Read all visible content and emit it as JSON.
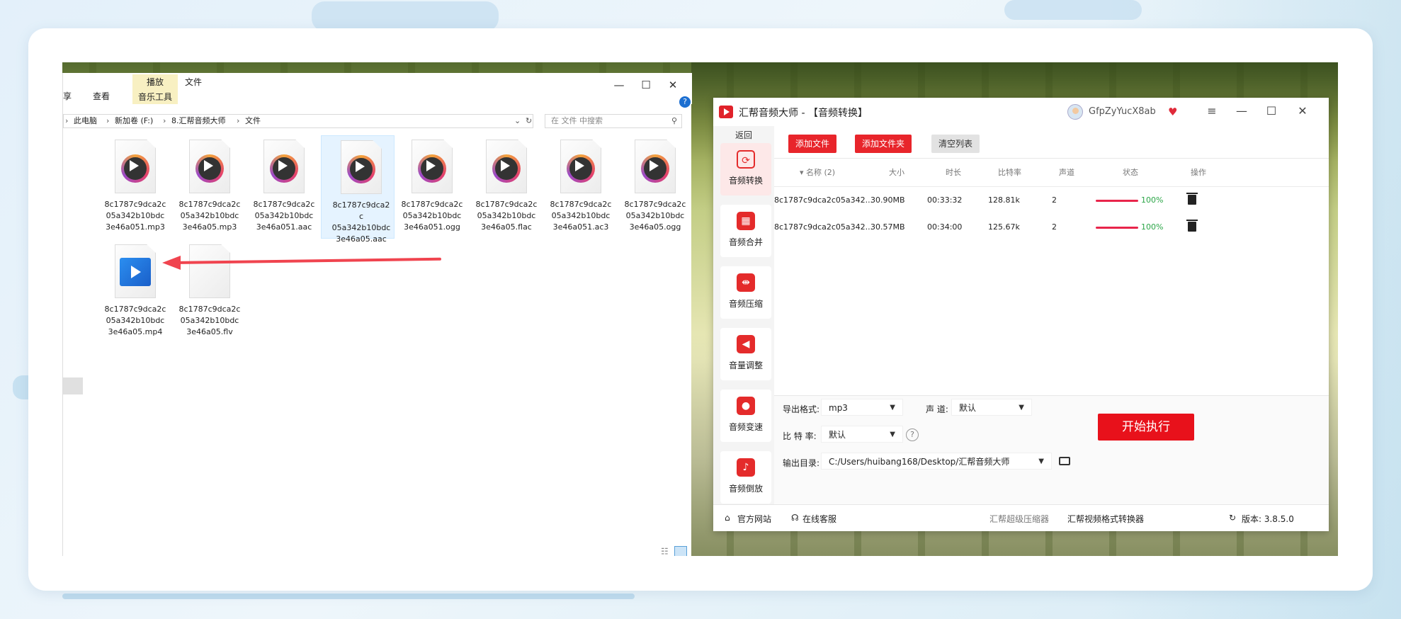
{
  "explorer": {
    "ribbon": {
      "share_fragment": "享",
      "view_tab": "查看",
      "play_tab": "播放",
      "music_tools_tab": "音乐工具",
      "file_tab": "文件"
    },
    "window_controls": {
      "minimize": "—",
      "maximize": "☐",
      "close": "✕"
    },
    "help": "?",
    "breadcrumb": [
      "此电脑",
      "新加卷 (F:)",
      "8.汇帮音频大师",
      "文件"
    ],
    "search_placeholder": "在 文件 中搜索",
    "files": [
      {
        "name": "8c1787c9dca2c05a342b10bdc3e46a051.mp3",
        "kind": "audio"
      },
      {
        "name": "8c1787c9dca2c05a342b10bdc3e46a05.mp3",
        "kind": "audio"
      },
      {
        "name": "8c1787c9dca2c05a342b10bdc3e46a051.aac",
        "kind": "audio"
      },
      {
        "name": "8c1787c9dca2c05a342b10bdc3e46a05.aac",
        "kind": "audio",
        "selected": true
      },
      {
        "name": "8c1787c9dca2c05a342b10bdc3e46a051.ogg",
        "kind": "audio"
      },
      {
        "name": "8c1787c9dca2c05a342b10bdc3e46a05.flac",
        "kind": "audio"
      },
      {
        "name": "8c1787c9dca2c05a342b10bdc3e46a051.ac3",
        "kind": "audio"
      },
      {
        "name": "8c1787c9dca2c05a342b10bdc3e46a05.ogg",
        "kind": "audio"
      },
      {
        "name": "8c1787c9dca2c05a342b10bdc3e46a05.mp4",
        "kind": "video"
      },
      {
        "name": "8c1787c9dca2c05a342b10bdc3e46a05.flv",
        "kind": "blank"
      }
    ],
    "file_name_lines": [
      [
        "8c1787c9dca2c",
        "05a342b10bdc",
        "3e46a051.mp3"
      ],
      [
        "8c1787c9dca2c",
        "05a342b10bdc",
        "3e46a05.mp3"
      ],
      [
        "8c1787c9dca2c",
        "05a342b10bdc",
        "3e46a051.aac"
      ],
      [
        "8c1787c9dca2c",
        "05a342b10bdc",
        "3e46a05.aac"
      ],
      [
        "8c1787c9dca2c",
        "05a342b10bdc",
        "3e46a051.ogg"
      ],
      [
        "8c1787c9dca2c",
        "05a342b10bdc",
        "3e46a05.flac"
      ],
      [
        "8c1787c9dca2c",
        "05a342b10bdc",
        "3e46a051.ac3"
      ],
      [
        "8c1787c9dca2c",
        "05a342b10bdc",
        "3e46a05.ogg"
      ],
      [
        "8c1787c9dca2c",
        "05a342b10bdc",
        "3e46a05.mp4"
      ],
      [
        "8c1787c9dca2c",
        "05a342b10bdc",
        "3e46a05.flv"
      ]
    ]
  },
  "app": {
    "title": "汇帮音频大师 - 【音频转换】",
    "username": "GfpZyYucX8ab",
    "window_controls": {
      "menu": "≡",
      "minimize": "—",
      "maximize": "☐",
      "close": "✕"
    },
    "back_label": "返回",
    "nav": [
      {
        "label": "音频转换",
        "icon": "convert-icon",
        "glyph": "⟳",
        "active": true
      },
      {
        "label": "音频合并",
        "icon": "merge-icon",
        "glyph": "▦"
      },
      {
        "label": "音频压缩",
        "icon": "compress-icon",
        "glyph": "⇼"
      },
      {
        "label": "音量调整",
        "icon": "volume-icon",
        "glyph": "◀"
      },
      {
        "label": "音频变速",
        "icon": "speed-icon",
        "glyph": "●"
      },
      {
        "label": "音频倒放",
        "icon": "reverse-icon",
        "glyph": "♪"
      }
    ],
    "toolbar": {
      "add_file": "添加文件",
      "add_folder": "添加文件夹",
      "clear_list": "清空列表"
    },
    "table": {
      "headers": {
        "name": "▾ 名称 (2)",
        "size": "大小",
        "duration": "时长",
        "bitrate": "比特率",
        "channels": "声道",
        "status": "状态",
        "actions": "操作"
      },
      "rows": [
        {
          "name": "8c1787c9dca2c05a342...",
          "size": "30.90MB",
          "duration": "00:33:32",
          "bitrate": "128.81k",
          "channels": "2",
          "progress": 1.0,
          "progress_label": "100%"
        },
        {
          "name": "8c1787c9dca2c05a342...",
          "size": "30.57MB",
          "duration": "00:34:00",
          "bitrate": "125.67k",
          "channels": "2",
          "progress": 1.0,
          "progress_label": "100%"
        }
      ]
    },
    "settings": {
      "format_label": "导出格式:",
      "format_value": "mp3",
      "channel_label": "声 道:",
      "channel_value": "默认",
      "bitrate_label": "比 特 率:",
      "bitrate_value": "默认",
      "help": "?",
      "output_label": "输出目录:",
      "output_value": "C:/Users/huibang168/Desktop/汇帮音频大师",
      "caret": "▼"
    },
    "start_button": "开始执行",
    "status": {
      "website": "官方网站",
      "support": "在线客服",
      "link1": "汇帮超级压缩器",
      "link2": "汇帮视频格式转换器",
      "version": "版本: 3.8.5.0"
    },
    "colors": {
      "accent": "#e8252b",
      "progress": "#e8254b",
      "success": "#2aa546"
    }
  }
}
